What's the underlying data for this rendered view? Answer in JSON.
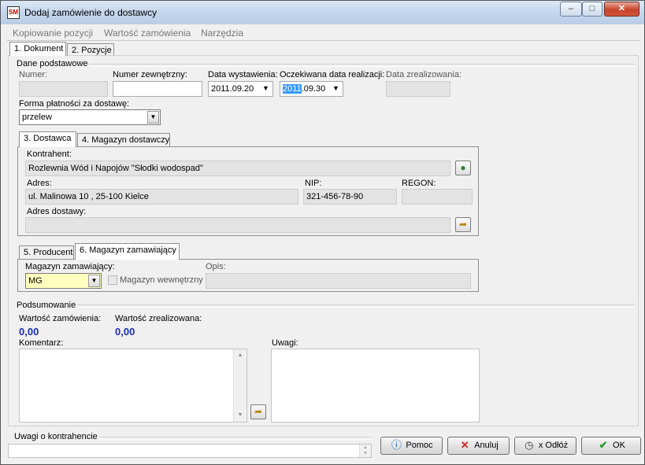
{
  "window": {
    "title": "Dodaj zamówienie do dostawcy",
    "app_icon_text": "SM",
    "minimize": "–",
    "maximize": "□",
    "close": "✕"
  },
  "menu": [
    "Kopiowanie pozycji",
    "Wartość zamówienia",
    "Narzędzia"
  ],
  "tabs_main": [
    "1. Dokument",
    "2. Pozycje"
  ],
  "basic": {
    "group_title": "Dane podstawowe",
    "numer_label": "Numer:",
    "numer_value": "",
    "numer_zew_label": "Numer zewnętrzny:",
    "numer_zew_value": "",
    "data_wyst_label": "Data wystawienia:",
    "data_wyst_value": "2011.09.20",
    "data_oczek_label": "Oczekiwana data realizacji:",
    "data_oczek_year": "2011",
    "data_oczek_rest": ".09.30",
    "data_zreal_label": "Data zrealizowania:",
    "data_zreal_value": "",
    "forma_label": "Forma płatności za dostawę:",
    "forma_value": "przelew"
  },
  "tabs_supplier": [
    "3. Dostawca",
    "4. Magazyn dostawczy"
  ],
  "supplier": {
    "kontrahent_label": "Kontrahent:",
    "kontrahent_value": "Rozlewnia Wód i Napojów \"Słodki wodospad\"",
    "adres_label": "Adres:",
    "adres_value": "ul. Malinowa 10  , 25-100 Kielce",
    "nip_label": "NIP:",
    "nip_value": "321-456-78-90",
    "regon_label": "REGON:",
    "regon_value": "",
    "adres_dostawy_label": "Adres dostawy:",
    "adres_dostawy_value": ""
  },
  "tabs_warehouse": [
    "5. Producent",
    "6. Magazyn zamawiający"
  ],
  "warehouse": {
    "magazyn_label": "Magazyn zamawiający:",
    "magazyn_value": "MG",
    "wewnetrzny_label": "Magazyn wewnętrzny",
    "opis_label": "Opis:",
    "opis_value": ""
  },
  "summary": {
    "group_title": "Podsumowanie",
    "wartosc_zam_label": "Wartość zamówienia:",
    "wartosc_zam_value": "0,00",
    "wartosc_zreal_label": "Wartość zrealizowana:",
    "wartosc_zreal_value": "0,00",
    "komentarz_label": "Komentarz:",
    "uwagi_label": "Uwagi:"
  },
  "footer": {
    "uwagi_kontr_label": "Uwagi o kontrahencie",
    "pomoc": "Pomoc",
    "anuluj": "Anuluj",
    "odloz": "x Odłóż",
    "ok": "OK"
  },
  "colors": {
    "value_blue": "#1a2fb0",
    "selection": "#3399ff",
    "highlight_field": "#ffffc0"
  },
  "icons": [
    "user-icon",
    "arrow-copy-icon",
    "info-icon",
    "x-icon",
    "clock-icon",
    "check-icon"
  ]
}
